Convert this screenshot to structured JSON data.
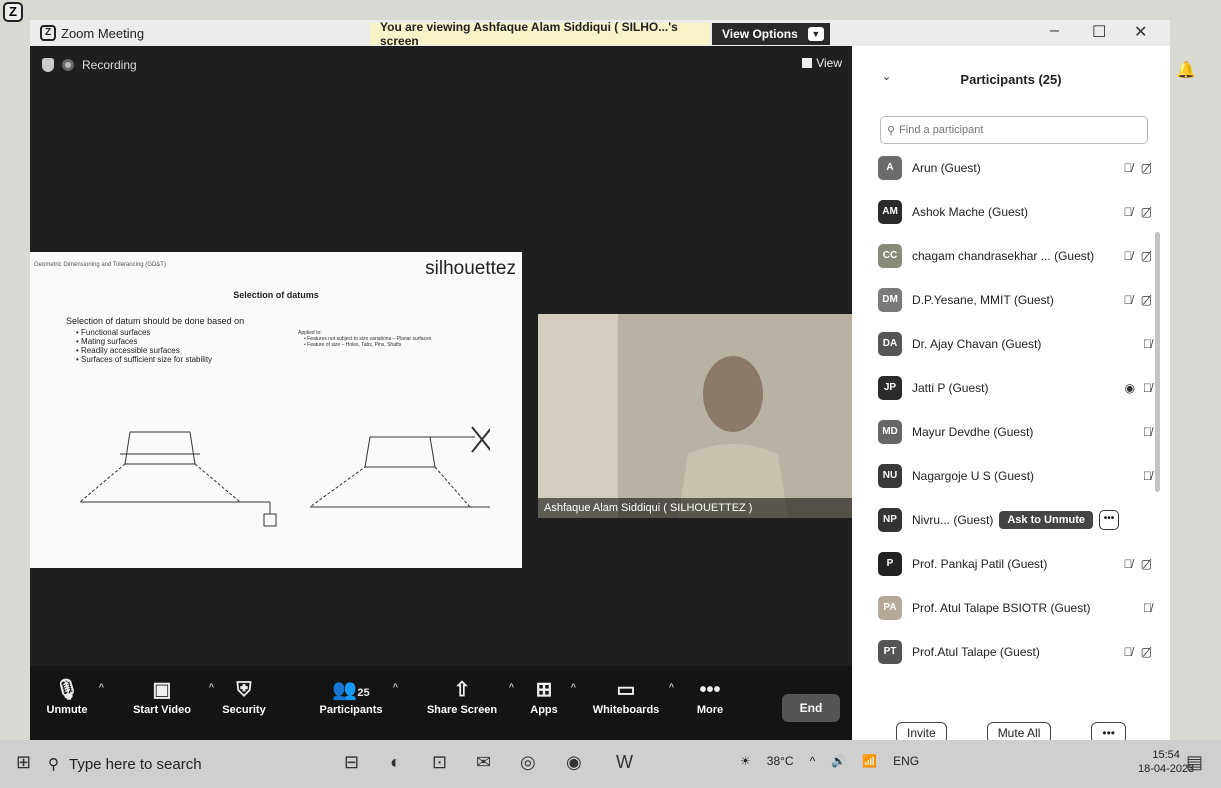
{
  "window": {
    "title": "Zoom Meeting",
    "viewing_banner": "You are viewing Ashfaque Alam Siddiqui ( SILHO...'s screen",
    "view_options": "View Options"
  },
  "meeting": {
    "recording_label": "Recording",
    "view_label": "View",
    "video_name": "Ashfaque Alam Siddiqui ( SILHOUETTEZ )"
  },
  "slide": {
    "header": "Geometric Dimensioning and Tolerancing (GD&T)",
    "logo": "silhouettez",
    "title": "Selection of datums",
    "intro": "Selection of datum should be done based on",
    "bullets": [
      "Functional surfaces",
      "Mating surfaces",
      "Readily accessible surfaces",
      "Surfaces of sufficient size for stability"
    ],
    "applied_title": "Applied to:",
    "applied_items": [
      "Features not subject to size variations – Planar surfaces",
      "Feature of size – Holes, Tabs, Pins, Shafts"
    ]
  },
  "toolbar": {
    "unmute": "Unmute",
    "start_video": "Start Video",
    "security": "Security",
    "participants": "Participants",
    "participants_count": "25",
    "share_screen": "Share Screen",
    "apps": "Apps",
    "whiteboards": "Whiteboards",
    "more": "More",
    "end": "End"
  },
  "panel": {
    "title": "Participants (25)",
    "search_placeholder": "Find a participant",
    "participants": [
      {
        "initials": "A",
        "name": "Arun (Guest)",
        "color": "#6b6b6b"
      },
      {
        "initials": "AM",
        "name": "Ashok Mache (Guest)",
        "color": "#2b2b2b"
      },
      {
        "initials": "CC",
        "name": "chagam chandrasekhar ... (Guest)",
        "color": "#8a8a7a"
      },
      {
        "initials": "DM",
        "name": "D.P.Yesane, MMIT (Guest)",
        "color": "#7a7a7a"
      },
      {
        "initials": "DA",
        "name": "Dr. Ajay Chavan (Guest)",
        "color": "#555555"
      },
      {
        "initials": "JP",
        "name": "Jatti P (Guest)",
        "color": "#2b2b2b"
      },
      {
        "initials": "MD",
        "name": "Mayur Devdhe (Guest)",
        "color": "#666666"
      },
      {
        "initials": "NU",
        "name": "Nagargoje U S (Guest)",
        "color": "#3a3a3a"
      },
      {
        "initials": "NP",
        "name": "Nivru... (Guest)",
        "color": "#333333"
      },
      {
        "initials": "P",
        "name": "Prof. Pankaj Patil (Guest)",
        "color": "#222222"
      },
      {
        "initials": "PA",
        "name": "Prof. Atul Talape BSIOTR (Guest)",
        "color": "#b5a999"
      },
      {
        "initials": "PT",
        "name": "Prof.Atul Talape (Guest)",
        "color": "#555555"
      }
    ],
    "ask_to_unmute": "Ask to Unmute",
    "invite": "Invite",
    "mute_all": "Mute All"
  },
  "taskbar": {
    "search_placeholder": "Type here to search",
    "temperature": "38°C",
    "language": "ENG",
    "time": "15:54",
    "date": "18-04-2023"
  }
}
